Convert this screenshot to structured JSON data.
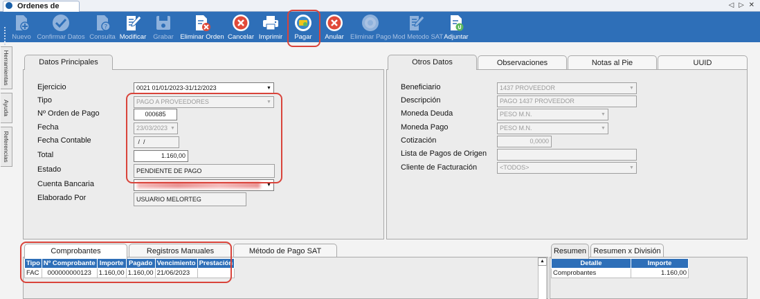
{
  "window": {
    "tab_title": "Ordenes de Pago",
    "nav_arrows": "◁ ▷ ✕"
  },
  "toolbar": [
    {
      "label": "Nuevo",
      "icon": "new-document-icon",
      "enabled": false
    },
    {
      "label": "Confirmar Datos",
      "icon": "checkmark-icon",
      "enabled": false
    },
    {
      "label": "Consulta",
      "icon": "query-document-icon",
      "enabled": false
    },
    {
      "label": "Modificar",
      "icon": "edit-document-icon",
      "enabled": true
    },
    {
      "label": "Grabar",
      "icon": "save-disk-icon",
      "enabled": false
    },
    {
      "label": "Eliminar Orden",
      "icon": "delete-document-icon",
      "enabled": true
    },
    {
      "label": "Cancelar",
      "icon": "cancel-icon",
      "enabled": true
    },
    {
      "label": "Imprimir",
      "icon": "printer-icon",
      "enabled": true
    },
    {
      "label": "Pagar",
      "icon": "pay-coins-icon",
      "enabled": true
    },
    {
      "label": "Anular",
      "icon": "void-icon",
      "enabled": true
    },
    {
      "label": "Eliminar Pago",
      "icon": "delete-payment-icon",
      "enabled": false
    },
    {
      "label": "Mod Metodo SAT",
      "icon": "edit-sat-method-icon",
      "enabled": false
    },
    {
      "label": "Adjuntar",
      "icon": "attach-document-icon",
      "enabled": true
    }
  ],
  "side_tabs": [
    "Herramientas",
    "Ayuda",
    "Referencias"
  ],
  "main_panel": {
    "tab": "Datos Principales",
    "labels": {
      "ejercicio": "Ejercicio",
      "tipo": "Tipo",
      "orden": "Nº Orden de Pago",
      "fecha": "Fecha",
      "fecha_contable": "Fecha Contable",
      "total": "Total",
      "estado": "Estado",
      "cuenta": "Cuenta Bancaria",
      "elaborado": "Elaborado Por"
    },
    "values": {
      "ejercicio": "0021 01/01/2023-31/12/2023",
      "tipo": "PAGO A PROVEEDORES",
      "orden": "000685",
      "fecha": "23/03/2023",
      "fecha_contable": " /  /",
      "total": "1.160,00",
      "estado": "PENDIENTE DE PAGO",
      "cuenta": "",
      "elaborado": "USUARIO MELORTEG"
    }
  },
  "other_panel": {
    "tabs": [
      "Otros Datos",
      "Observaciones",
      "Notas al Pie",
      "UUID"
    ],
    "labels": {
      "beneficiario": "Beneficiario",
      "descripcion": "Descripción",
      "moneda_deuda": "Moneda Deuda",
      "moneda_pago": "Moneda Pago",
      "cotizacion": "Cotización",
      "lista_pagos": "Lista de Pagos de Origen",
      "cliente": "Cliente de Facturación"
    },
    "values": {
      "beneficiario": "1437 PROVEEDOR",
      "descripcion": "PAGO 1437 PROVEEDOR",
      "moneda_deuda": "PESO M.N.",
      "moneda_pago": "PESO M.N.",
      "cotizacion": "0,0000",
      "lista_pagos": "",
      "cliente": "<TODOS>"
    }
  },
  "bottom_left": {
    "tabs": [
      "Comprobantes",
      "Registros Manuales",
      "Método de Pago SAT"
    ],
    "columns": [
      "Tipo",
      "Nº Comprobante",
      "Importe",
      "Pagado",
      "Vencimiento",
      "Prestación"
    ],
    "rows": [
      [
        "FAC",
        "000000000123",
        "1.160,00",
        "1.160,00",
        "21/06/2023",
        ""
      ]
    ],
    "scroll_up": "▲"
  },
  "bottom_right": {
    "tabs": [
      "Resumen",
      "Resumen x División"
    ],
    "columns": [
      "Detalle",
      "Importe"
    ],
    "rows": [
      [
        "Comprobantes",
        "1.160,00"
      ]
    ]
  },
  "colors": {
    "toolbar": "#2e6fb8",
    "highlight": "#d9433a",
    "grid_header": "#2e6fb8"
  }
}
